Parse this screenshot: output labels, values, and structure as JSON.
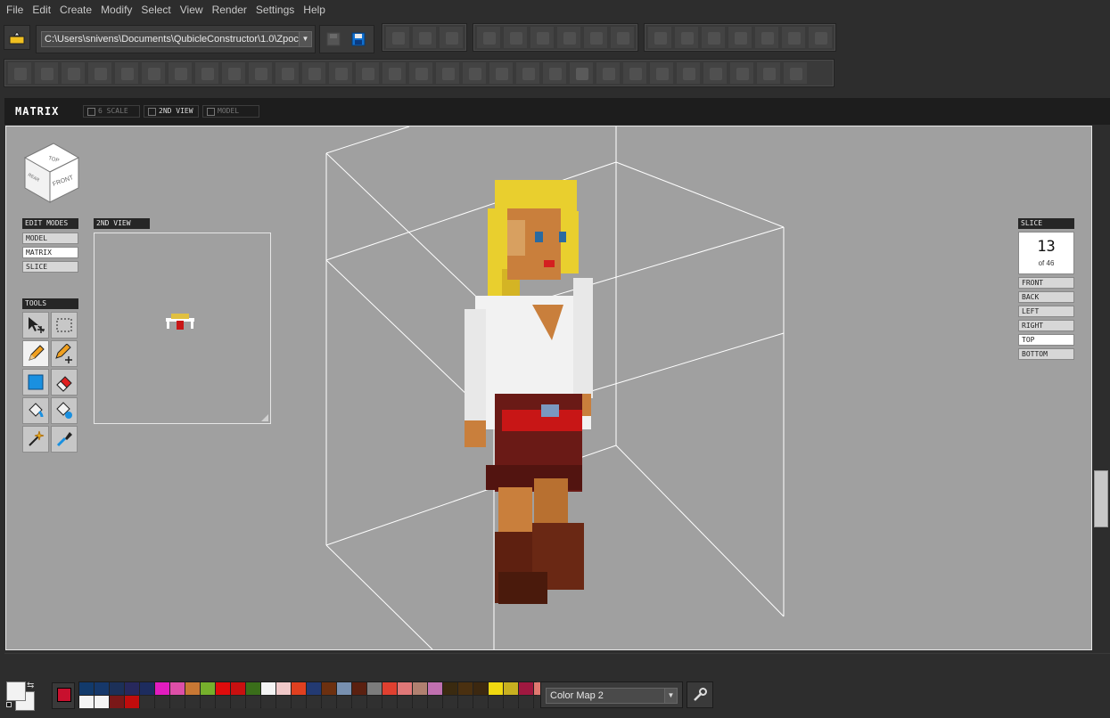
{
  "menu": [
    "File",
    "Edit",
    "Create",
    "Modify",
    "Select",
    "View",
    "Render",
    "Settings",
    "Help"
  ],
  "toolbar": {
    "path_value": "C:\\Users\\snivens\\Documents\\QubicleConstructor\\1.0\\Zpoc",
    "icons": [
      "open-folder-icon",
      "save-icon",
      "save-as-icon"
    ]
  },
  "view_header": {
    "title": "MATRIX",
    "tabs": [
      {
        "label": "6 SCALE",
        "active": false
      },
      {
        "label": "2ND VIEW",
        "active": true
      },
      {
        "label": "MODEL",
        "active": false
      }
    ]
  },
  "nav_cube": {
    "top": "TOP",
    "front": "FRONT",
    "rear": "REAR"
  },
  "edit_modes": {
    "label": "EDIT MODES",
    "items": [
      {
        "label": "MODEL",
        "active": false
      },
      {
        "label": "MATRIX",
        "active": true
      },
      {
        "label": "SLICE",
        "active": false
      }
    ]
  },
  "second_view": {
    "label": "2ND VIEW"
  },
  "tools": {
    "label": "TOOLS",
    "items": [
      "move-select-icon",
      "marquee-select-icon",
      "pencil-icon",
      "pencil-add-icon",
      "fill-rect-icon",
      "eraser-icon",
      "paint-bucket-icon",
      "paint-bucket-add-icon",
      "magic-wand-icon",
      "eyedropper-icon"
    ]
  },
  "slice": {
    "label": "SLICE",
    "number": "13",
    "of_text": "of 46",
    "directions": [
      {
        "label": "FRONT",
        "active": false
      },
      {
        "label": "BACK",
        "active": false
      },
      {
        "label": "LEFT",
        "active": false
      },
      {
        "label": "RIGHT",
        "active": false
      },
      {
        "label": "TOP",
        "active": true
      },
      {
        "label": "BOTTOM",
        "active": false
      }
    ]
  },
  "colors": {
    "current": "#c8102e",
    "viewport_bg": "#a0a0a0",
    "palette_row1": [
      "#123a6b",
      "#16386a",
      "#1c3058",
      "#27285c",
      "#1d2c5e",
      "#e21cc0",
      "#dd4fa8",
      "#c87834",
      "#76b02c",
      "#e00c0c",
      "#c81010",
      "#3a6e1a",
      "#f4f4f4",
      "#f0c8c8",
      "#e04020",
      "#233a72",
      "#6c3010",
      "#7890b0",
      "#5a2010",
      "#7c7c7c",
      "#e04030",
      "#e07878",
      "#b08070",
      "#c070b0",
      "#3a2a10",
      "#4a3010",
      "#3c2810",
      "#f0d810",
      "#c8b020",
      "#a01840",
      "#e07870",
      "#e0c040"
    ],
    "palette_row2": [
      "#f4f4f4",
      "#f4f4f4",
      "#7a1818",
      "#c00c0c",
      "#303030",
      "#303030",
      "#303030",
      "#303030",
      "#303030",
      "#303030",
      "#303030",
      "#303030",
      "#303030",
      "#303030",
      "#303030",
      "#303030",
      "#303030",
      "#303030",
      "#303030",
      "#303030",
      "#303030",
      "#303030",
      "#303030",
      "#303030",
      "#303030",
      "#303030",
      "#303030",
      "#303030",
      "#303030",
      "#303030",
      "#303030",
      "#303030"
    ]
  },
  "color_map": {
    "value": "Color Map 2"
  }
}
